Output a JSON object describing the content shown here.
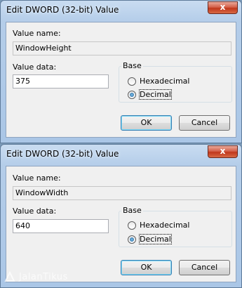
{
  "dialogs": [
    {
      "title": "Edit DWORD (32-bit) Value",
      "close_glyph": "x",
      "value_name_label": "Value name:",
      "value_name": "WindowHeight",
      "value_data_label": "Value data:",
      "value_data": "375",
      "base_label": "Base",
      "radio_hex": {
        "label": "Hexadecimal",
        "checked": false
      },
      "radio_dec": {
        "label": "Decimal",
        "checked": true
      },
      "ok_label": "OK",
      "cancel_label": "Cancel"
    },
    {
      "title": "Edit DWORD (32-bit) Value",
      "close_glyph": "x",
      "value_name_label": "Value name:",
      "value_name": "WindowWidth",
      "value_data_label": "Value data:",
      "value_data": "640",
      "base_label": "Base",
      "radio_hex": {
        "label": "Hexadecimal",
        "checked": false
      },
      "radio_dec": {
        "label": "Decimal",
        "checked": true
      },
      "ok_label": "OK",
      "cancel_label": "Cancel"
    }
  ],
  "watermark": {
    "text": "JalanTikus"
  },
  "colors": {
    "titlebar": "#b4cde9",
    "close_button": "#c0371c",
    "dialog_body": "#f0f0f0"
  }
}
